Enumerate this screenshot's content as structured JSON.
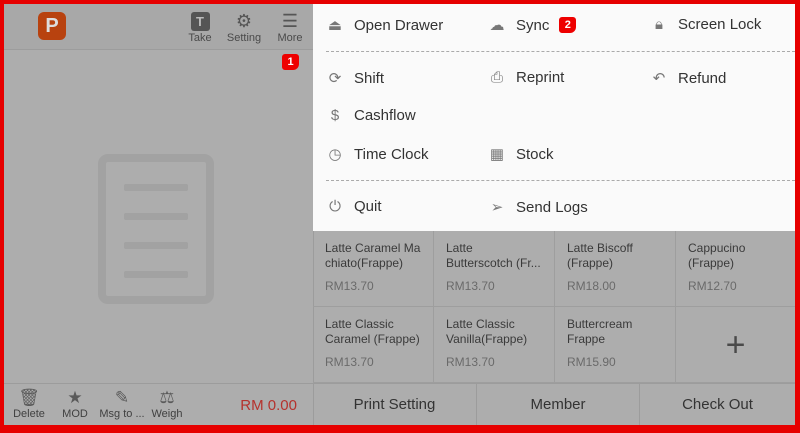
{
  "header": {
    "logo_letter": "P",
    "buttons": [
      {
        "label": "Take",
        "icon": "T"
      },
      {
        "label": "Setting",
        "icon": "gear"
      },
      {
        "label": "More",
        "icon": "list"
      }
    ],
    "more_badge": "1"
  },
  "footer_left": {
    "buttons": [
      {
        "label": "Delete"
      },
      {
        "label": "MOD"
      },
      {
        "label": "Msg to ..."
      },
      {
        "label": "Weigh"
      }
    ],
    "total": "RM 0.00"
  },
  "menu": {
    "row1": [
      {
        "label": "Open Drawer"
      },
      {
        "label": "Sync",
        "badge": "2"
      },
      {
        "label": "Screen Lock"
      }
    ],
    "row2": [
      {
        "label": "Shift"
      },
      {
        "label": "Reprint"
      },
      {
        "label": "Refund"
      }
    ],
    "row3": [
      {
        "label": "Cashflow"
      }
    ],
    "row4": [
      {
        "label": "Time Clock"
      },
      {
        "label": "Stock"
      }
    ],
    "row5": [
      {
        "label": "Quit"
      },
      {
        "label": "Send Logs"
      }
    ]
  },
  "products": [
    {
      "name": "Latte Caramel Ma chiato(Frappe)",
      "price": "RM13.70"
    },
    {
      "name": "Latte Butterscotch (Fr...",
      "price": "RM13.70"
    },
    {
      "name": "Latte Biscoff (Frappe)",
      "price": "RM18.00"
    },
    {
      "name": "Cappucino (Frappe)",
      "price": "RM12.70"
    },
    {
      "name": "Latte Classic Caramel (Frappe)",
      "price": "RM13.70"
    },
    {
      "name": "Latte Classic Vanilla(Frappe)",
      "price": "RM13.70"
    },
    {
      "name": "Buttercream Frappe",
      "price": "RM15.90"
    }
  ],
  "add_label": "+",
  "footer_right": {
    "print_setting": "Print Setting",
    "member": "Member",
    "checkout": "Check Out"
  },
  "colors": {
    "accent": "#e60000",
    "logo": "#b8420f",
    "total": "#b5322d"
  }
}
